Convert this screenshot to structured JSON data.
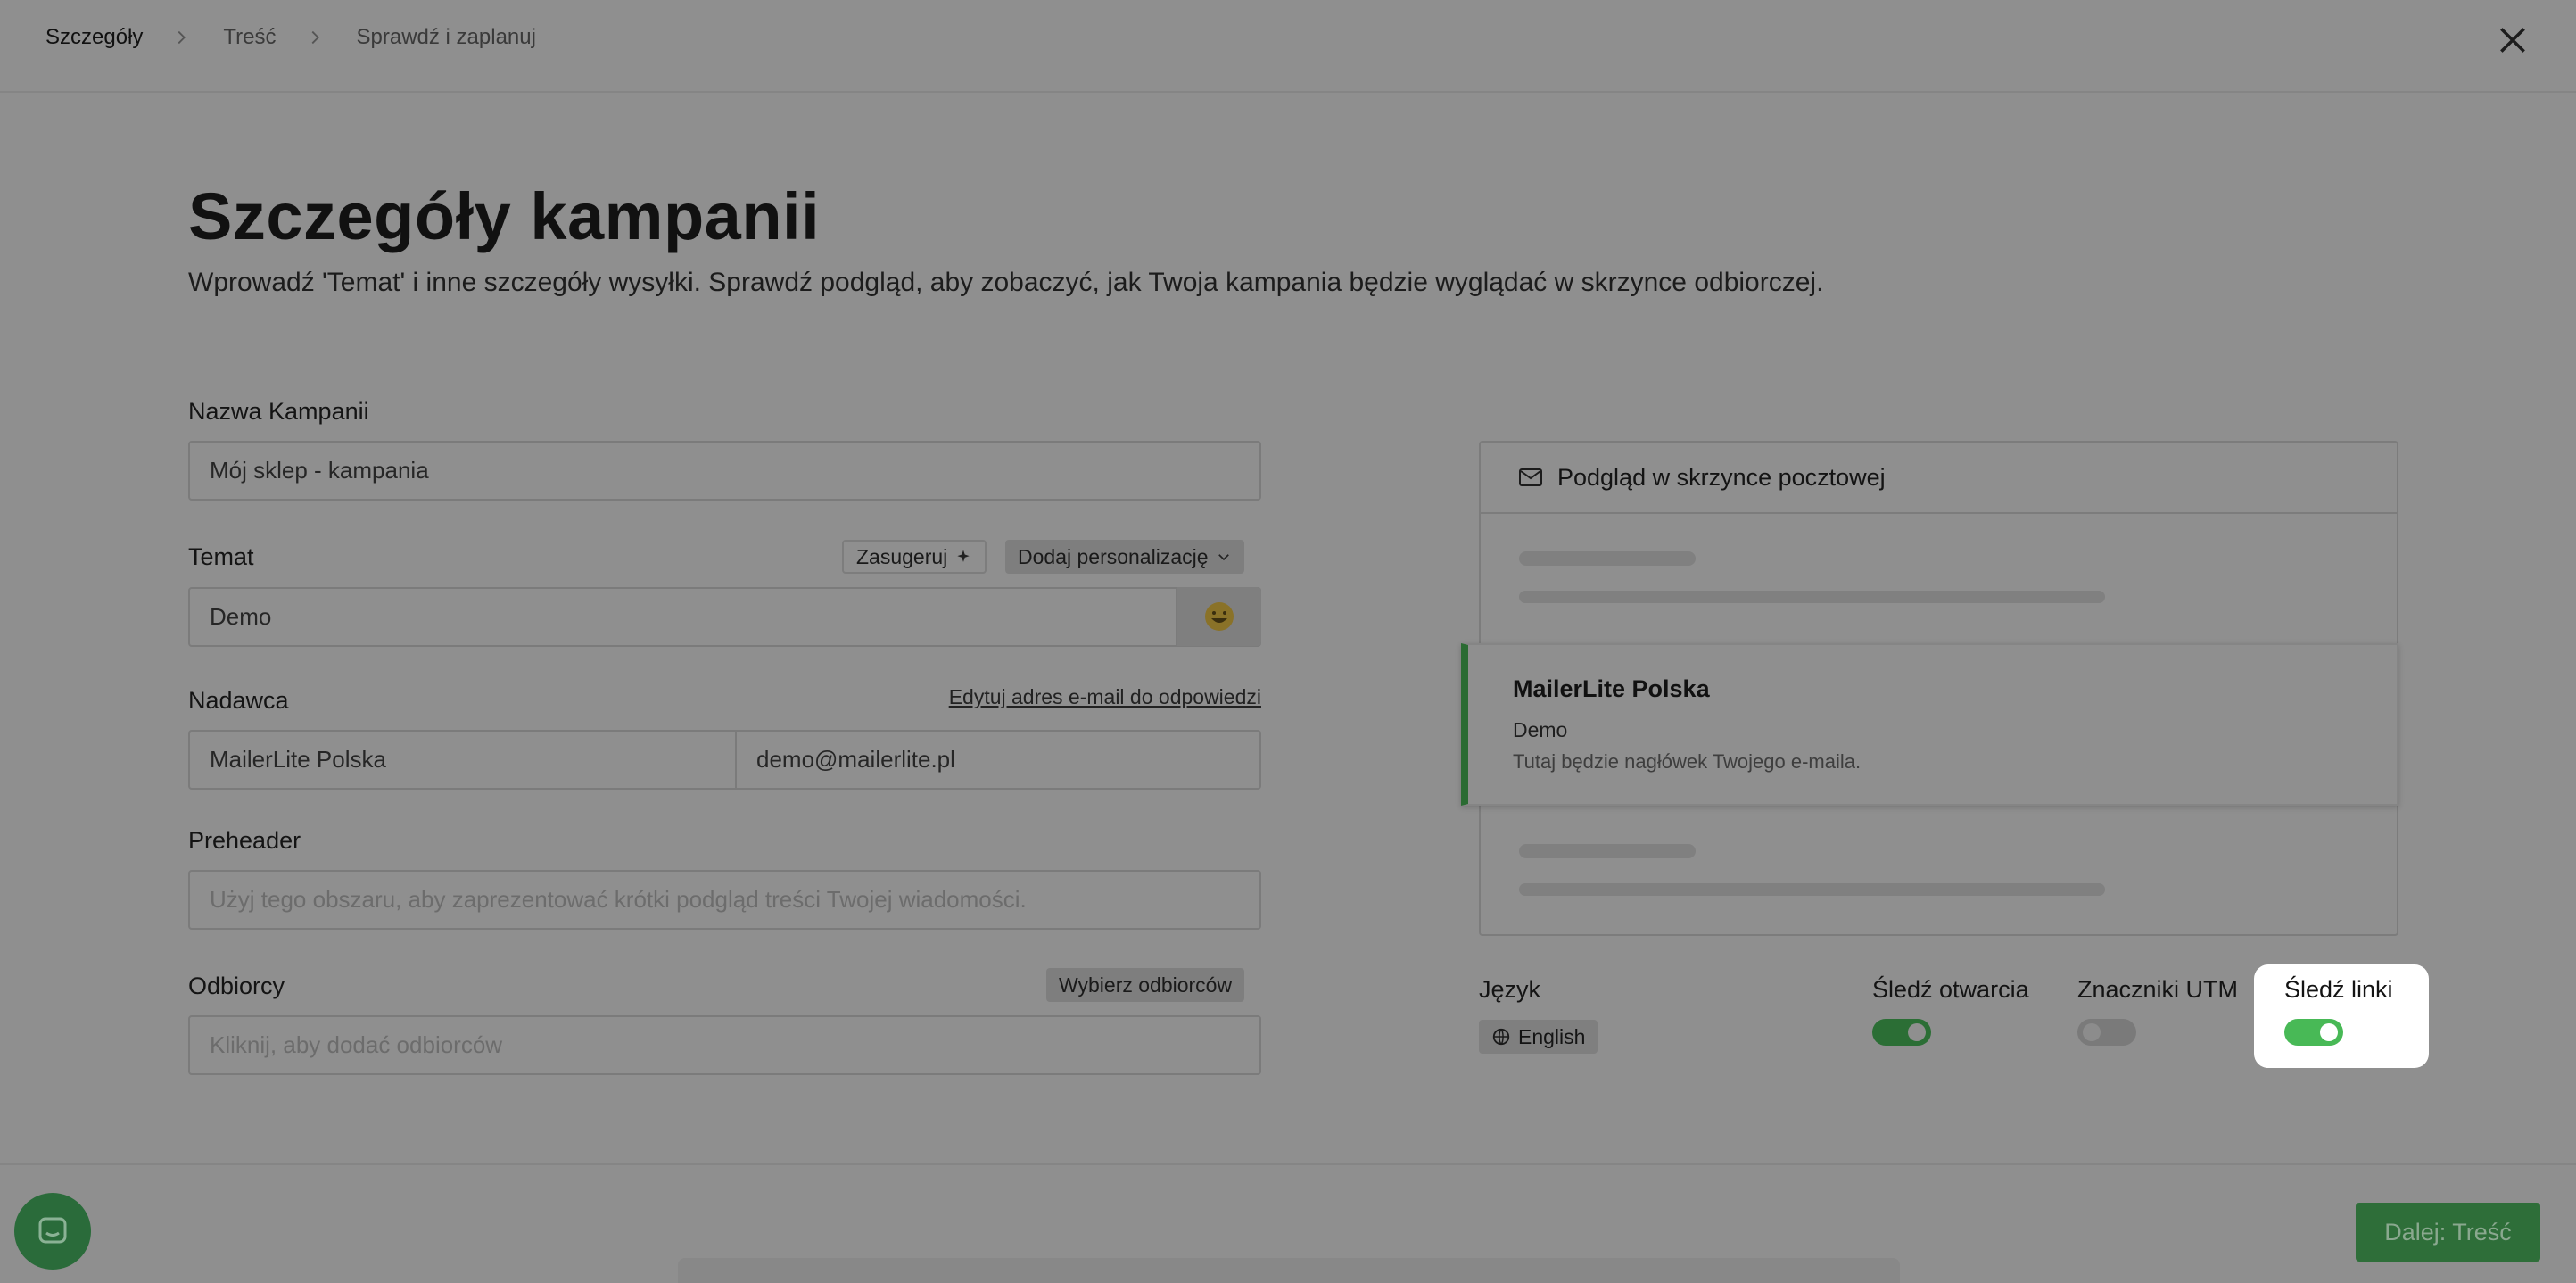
{
  "breadcrumb": {
    "items": [
      "Szczegóły",
      "Treść",
      "Sprawdź i zaplanuj"
    ]
  },
  "header": {
    "title": "Szczegóły kampanii",
    "subtitle": "Wprowadź 'Temat' i inne szczegóły wysyłki. Sprawdź podgląd, aby zobaczyć, jak Twoja kampania będzie wyglądać w skrzynce odbiorczej."
  },
  "form": {
    "campaign_name": {
      "label": "Nazwa Kampanii",
      "value": "Mój sklep - kampania"
    },
    "subject": {
      "label": "Temat",
      "value": "Demo",
      "suggest": "Zasugeruj",
      "personalize": "Dodaj personalizację",
      "emoji": "😀"
    },
    "sender": {
      "label": "Nadawca",
      "reply_link": "Edytuj adres e-mail do odpowiedzi",
      "name": "MailerLite Polska",
      "email": "demo@mailerlite.pl"
    },
    "preheader": {
      "label": "Preheader",
      "placeholder": "Użyj tego obszaru, aby zaprezentować krótki podgląd treści Twojej wiadomości."
    },
    "recipients": {
      "label": "Odbiorcy",
      "choose": "Wybierz odbiorców",
      "placeholder": "Kliknij, aby dodać odbiorców"
    }
  },
  "preview": {
    "title": "Podgląd w skrzynce pocztowej",
    "from": "MailerLite Polska",
    "subject": "Demo",
    "preheader": "Tutaj będzie nagłówek Twojego e-maila."
  },
  "options": {
    "language": {
      "label": "Język",
      "value": "English"
    },
    "track_opens": {
      "label": "Śledź otwarcia",
      "on": true
    },
    "utm": {
      "label": "Znaczniki UTM",
      "on": false
    },
    "track_links": {
      "label": "Śledź linki",
      "on": true
    }
  },
  "footer": {
    "next_label": "Dalej: Treść"
  },
  "colors": {
    "accent": "#48b956",
    "accent_dimmed": "#2b6e35",
    "overlay": "#8f8f8f"
  }
}
